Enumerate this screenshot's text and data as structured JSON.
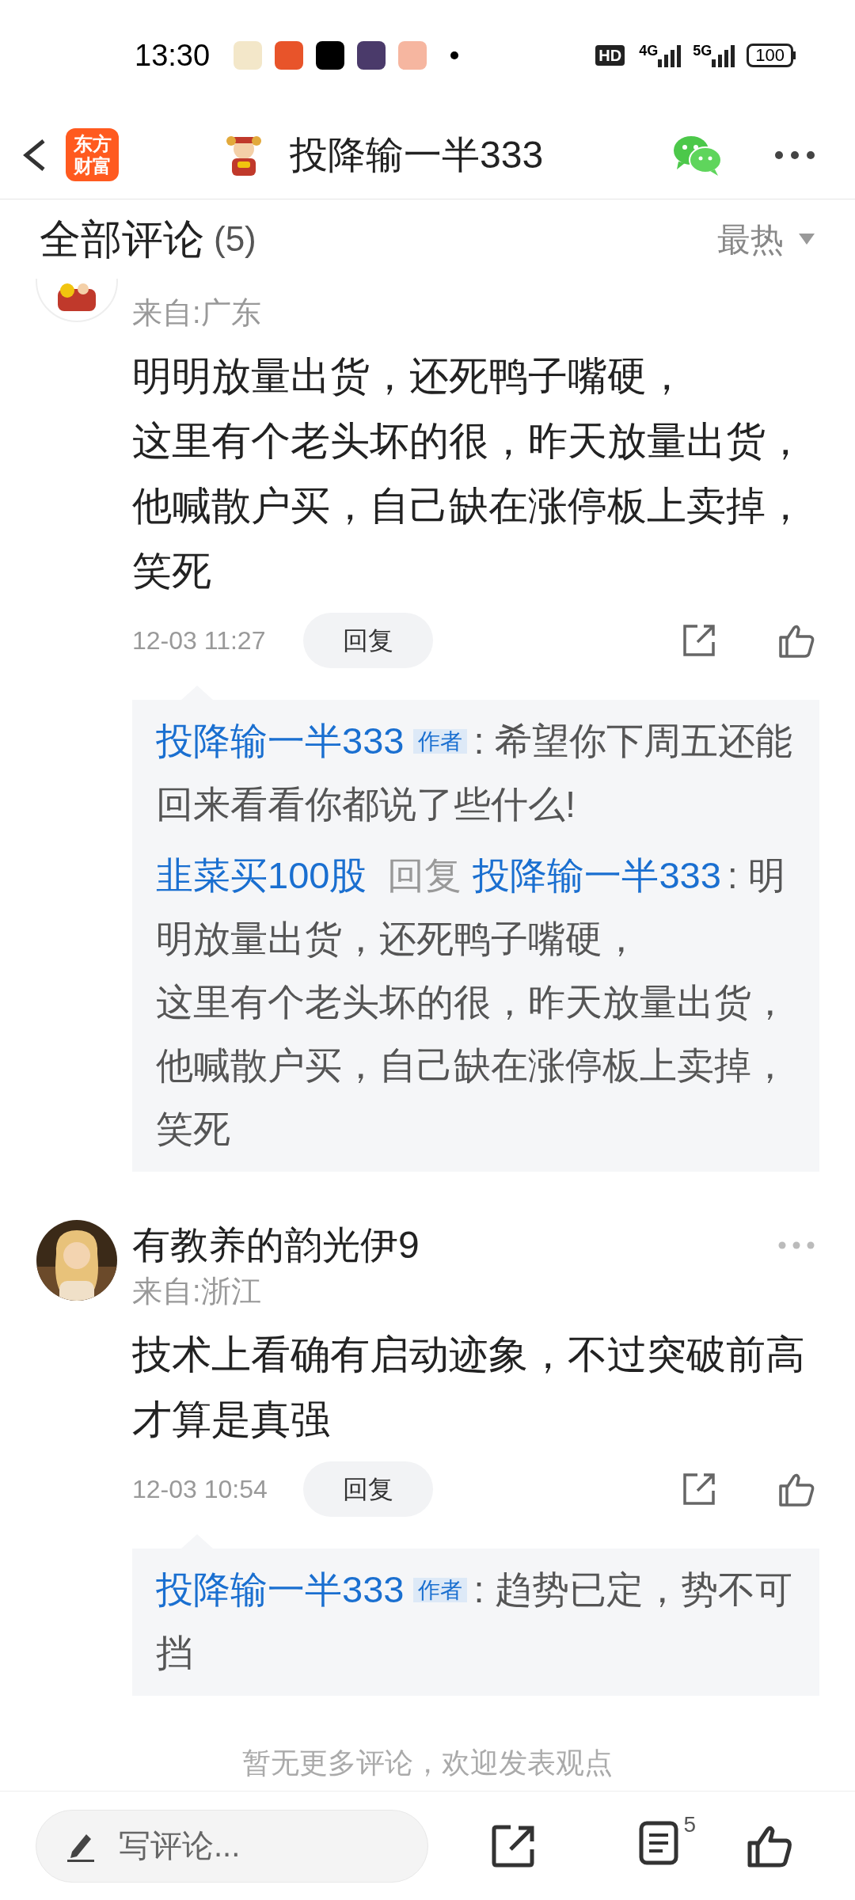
{
  "status_bar": {
    "time": "13:30",
    "hd": "HD",
    "net_4g": "4G",
    "net_5g": "5G",
    "battery": "100"
  },
  "header": {
    "logo_lines": [
      "东方",
      "财富"
    ],
    "title": "投降输一半333"
  },
  "comments_header": {
    "title": "全部评论",
    "count": "(5)",
    "sort": "最热"
  },
  "comments": [
    {
      "location": "来自:广东",
      "text_lines": [
        "明明放量出货，还死鸭子嘴硬，",
        "这里有个老头坏的很，昨天放量出货，",
        "他喊散户买，自己缺在涨停板上卖掉，",
        "笑死"
      ],
      "time": "12-03 11:27",
      "reply_button": "回复",
      "replies": [
        {
          "author": "投降输一半333",
          "badge": "作者",
          "text_lines": [
            ": 希望你下周五还能回来看看你都说了些什么!"
          ]
        },
        {
          "author": "韭菜买100股",
          "reply_word": "回复",
          "reply_to": "投降输一半333",
          "text_lines": [
            ": 明明放量出货，还死鸭子嘴硬，",
            "这里有个老头坏的很，昨天放量出货，",
            "他喊散户买，自己缺在涨停板上卖掉，",
            "笑死"
          ]
        }
      ]
    },
    {
      "author": "有教养的韵光伊9",
      "location": "来自:浙江",
      "text_lines": [
        "技术上看确有启动迹象，不过突破前高才算是真强"
      ],
      "time": "12-03 10:54",
      "reply_button": "回复",
      "replies": [
        {
          "author": "投降输一半333",
          "badge": "作者",
          "text_lines": [
            ": 趋势已定，势不可挡"
          ]
        }
      ]
    }
  ],
  "footer_note": "暂无更多评论，欢迎发表观点",
  "bottom_bar": {
    "placeholder": "写评论...",
    "comment_count": "5"
  }
}
